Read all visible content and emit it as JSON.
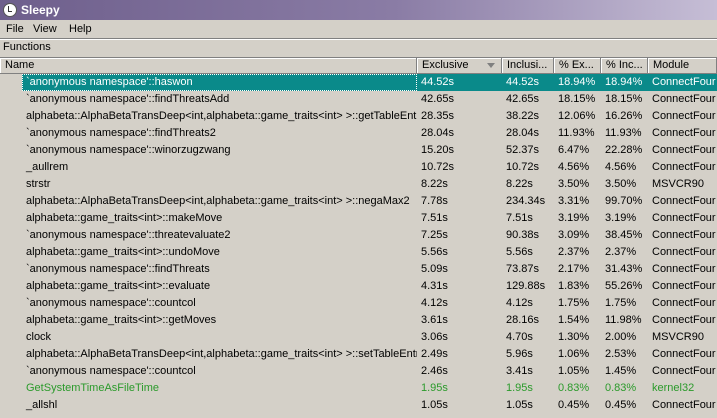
{
  "window": {
    "title": "Sleepy"
  },
  "menu": {
    "items": [
      "File",
      "View",
      "Help"
    ]
  },
  "section": {
    "label": "Functions"
  },
  "table": {
    "columns": [
      "Name",
      "Exclusive",
      "Inclusi...",
      "% Ex...",
      "% Inc...",
      "Module"
    ],
    "rows": [
      {
        "name": "`anonymous namespace'::haswon",
        "exclusive": "44.52s",
        "inclusive": "44.52s",
        "pct_ex": "18.94%",
        "pct_inc": "18.94%",
        "module": "ConnectFour",
        "selected": true
      },
      {
        "name": "`anonymous namespace'::findThreatsAdd",
        "exclusive": "42.65s",
        "inclusive": "42.65s",
        "pct_ex": "18.15%",
        "pct_inc": "18.15%",
        "module": "ConnectFour"
      },
      {
        "name": "alphabeta::AlphaBetaTransDeep<int,alphabeta::game_traits<int> >::getTableEntry",
        "exclusive": "28.35s",
        "inclusive": "38.22s",
        "pct_ex": "12.06%",
        "pct_inc": "16.26%",
        "module": "ConnectFour"
      },
      {
        "name": "`anonymous namespace'::findThreats2",
        "exclusive": "28.04s",
        "inclusive": "28.04s",
        "pct_ex": "11.93%",
        "pct_inc": "11.93%",
        "module": "ConnectFour"
      },
      {
        "name": "`anonymous namespace'::winorzugzwang",
        "exclusive": "15.20s",
        "inclusive": "52.37s",
        "pct_ex": "6.47%",
        "pct_inc": "22.28%",
        "module": "ConnectFour"
      },
      {
        "name": "_aullrem",
        "exclusive": "10.72s",
        "inclusive": "10.72s",
        "pct_ex": "4.56%",
        "pct_inc": "4.56%",
        "module": "ConnectFour"
      },
      {
        "name": "strstr",
        "exclusive": "8.22s",
        "inclusive": "8.22s",
        "pct_ex": "3.50%",
        "pct_inc": "3.50%",
        "module": "MSVCR90"
      },
      {
        "name": "alphabeta::AlphaBetaTransDeep<int,alphabeta::game_traits<int> >::negaMax2",
        "exclusive": "7.78s",
        "inclusive": "234.34s",
        "pct_ex": "3.31%",
        "pct_inc": "99.70%",
        "module": "ConnectFour"
      },
      {
        "name": "alphabeta::game_traits<int>::makeMove",
        "exclusive": "7.51s",
        "inclusive": "7.51s",
        "pct_ex": "3.19%",
        "pct_inc": "3.19%",
        "module": "ConnectFour"
      },
      {
        "name": "`anonymous namespace'::threatevaluate2",
        "exclusive": "7.25s",
        "inclusive": "90.38s",
        "pct_ex": "3.09%",
        "pct_inc": "38.45%",
        "module": "ConnectFour"
      },
      {
        "name": "alphabeta::game_traits<int>::undoMove",
        "exclusive": "5.56s",
        "inclusive": "5.56s",
        "pct_ex": "2.37%",
        "pct_inc": "2.37%",
        "module": "ConnectFour"
      },
      {
        "name": "`anonymous namespace'::findThreats",
        "exclusive": "5.09s",
        "inclusive": "73.87s",
        "pct_ex": "2.17%",
        "pct_inc": "31.43%",
        "module": "ConnectFour"
      },
      {
        "name": "alphabeta::game_traits<int>::evaluate",
        "exclusive": "4.31s",
        "inclusive": "129.88s",
        "pct_ex": "1.83%",
        "pct_inc": "55.26%",
        "module": "ConnectFour"
      },
      {
        "name": "`anonymous namespace'::countcol",
        "exclusive": "4.12s",
        "inclusive": "4.12s",
        "pct_ex": "1.75%",
        "pct_inc": "1.75%",
        "module": "ConnectFour"
      },
      {
        "name": "alphabeta::game_traits<int>::getMoves",
        "exclusive": "3.61s",
        "inclusive": "28.16s",
        "pct_ex": "1.54%",
        "pct_inc": "11.98%",
        "module": "ConnectFour"
      },
      {
        "name": "clock",
        "exclusive": "3.06s",
        "inclusive": "4.70s",
        "pct_ex": "1.30%",
        "pct_inc": "2.00%",
        "module": "MSVCR90"
      },
      {
        "name": "alphabeta::AlphaBetaTransDeep<int,alphabeta::game_traits<int> >::setTableEntry",
        "exclusive": "2.49s",
        "inclusive": "5.96s",
        "pct_ex": "1.06%",
        "pct_inc": "2.53%",
        "module": "ConnectFour"
      },
      {
        "name": "`anonymous namespace'::countcol",
        "exclusive": "2.46s",
        "inclusive": "3.41s",
        "pct_ex": "1.05%",
        "pct_inc": "1.45%",
        "module": "ConnectFour"
      },
      {
        "name": "GetSystemTimeAsFileTime",
        "exclusive": "1.95s",
        "inclusive": "1.95s",
        "pct_ex": "0.83%",
        "pct_inc": "0.83%",
        "module": "kernel32",
        "green": true
      },
      {
        "name": "_allshl",
        "exclusive": "1.05s",
        "inclusive": "1.05s",
        "pct_ex": "0.45%",
        "pct_inc": "0.45%",
        "module": "ConnectFour"
      }
    ]
  },
  "colors": {
    "selection": "#0a8a8a",
    "system_call": "#2b9a2b",
    "titlebar": "#6e5f8c"
  }
}
